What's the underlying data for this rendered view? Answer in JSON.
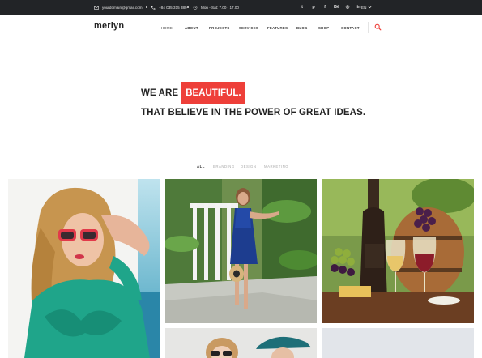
{
  "topbar": {
    "email": "yourdomain@gmail.com",
    "phone": "+84 035 315 389",
    "hours": "Mon - Sat: 7.00 - 17.00",
    "social_icons": [
      "twitter-icon",
      "pinterest-icon",
      "facebook-icon",
      "behance-icon",
      "instagram-icon",
      "linkedin-icon"
    ],
    "language": "EN"
  },
  "header": {
    "logo": "merlyn",
    "nav": [
      "HOME",
      "ABOUT",
      "PROJECTS",
      "SERVICES",
      "FEATURES",
      "BLOG",
      "SHOP",
      "CONTACT"
    ],
    "active_nav": "HOME"
  },
  "hero": {
    "line1_prefix": "WE ARE",
    "line1_highlight": "BEAUTIFUL.",
    "line2": "THAT BELIEVE IN THE POWER OF GREAT IDEAS."
  },
  "filters": {
    "items": [
      "ALL",
      "BRANDING",
      "DESIGN",
      "MARKETING"
    ],
    "active": "ALL"
  },
  "gallery": {
    "items": [
      "woman-sunglasses-photo",
      "woman-blue-dress-photo",
      "wine-grapes-photo",
      "two-women-hats-photo",
      "grey-placeholder-photo"
    ]
  },
  "colors": {
    "accent": "#ee3f39",
    "topbar_bg": "#222427",
    "text_dark": "#222222"
  }
}
